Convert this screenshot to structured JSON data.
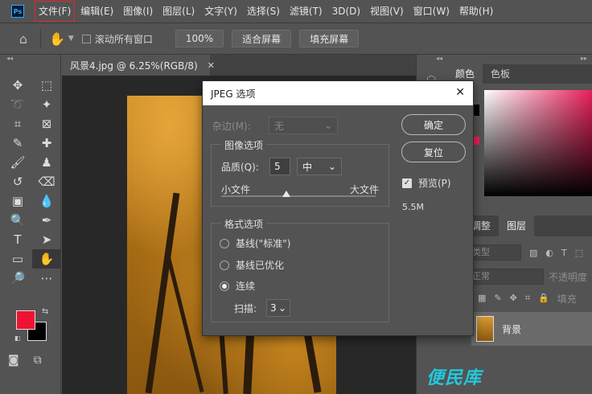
{
  "app": {
    "logo": "Ps"
  },
  "menu": [
    {
      "label": "文件(F)",
      "highlighted": true
    },
    {
      "label": "编辑(E)"
    },
    {
      "label": "图像(I)"
    },
    {
      "label": "图层(L)"
    },
    {
      "label": "文字(Y)"
    },
    {
      "label": "选择(S)"
    },
    {
      "label": "滤镜(T)"
    },
    {
      "label": "3D(D)"
    },
    {
      "label": "视图(V)"
    },
    {
      "label": "窗口(W)"
    },
    {
      "label": "帮助(H)"
    }
  ],
  "options_bar": {
    "scroll_all_label": "滚动所有窗口",
    "zoom_pct": "100%",
    "fit_screen": "适合屏幕",
    "fill_screen": "填充屏幕"
  },
  "document": {
    "tab_title": "风景4.jpg @ 6.25%(RGB/8)",
    "close_glyph": "✕"
  },
  "color_panel": {
    "tabs": [
      "颜色",
      "色板"
    ],
    "foreground": "#f01232",
    "background": "#000000"
  },
  "layers_panel": {
    "tabs": [
      "调整",
      "图层"
    ],
    "kind_placeholder": "类型",
    "blend_mode": "正常",
    "opacity_label": "不透明度",
    "fill_label": "填充",
    "layer_name": "背景"
  },
  "dialog": {
    "title": "JPEG 选项",
    "matte_label": "杂边(M):",
    "matte_value": "无",
    "image_options_label": "图像选项",
    "quality_label": "品质(Q):",
    "quality_value": "5",
    "quality_level": "中",
    "slider_min_label": "小文件",
    "slider_max_label": "大文件",
    "slider_position": 0.42,
    "format_options_label": "格式选项",
    "radios": [
      {
        "label": "基线(\"标准\")",
        "checked": false
      },
      {
        "label": "基线已优化",
        "checked": false
      },
      {
        "label": "连续",
        "checked": true
      }
    ],
    "scan_label": "扫描:",
    "scan_value": "3",
    "ok_label": "确定",
    "reset_label": "复位",
    "preview_label": "预览(P)",
    "preview_checked": true,
    "file_size": "5.5M"
  },
  "watermark": "便民库"
}
